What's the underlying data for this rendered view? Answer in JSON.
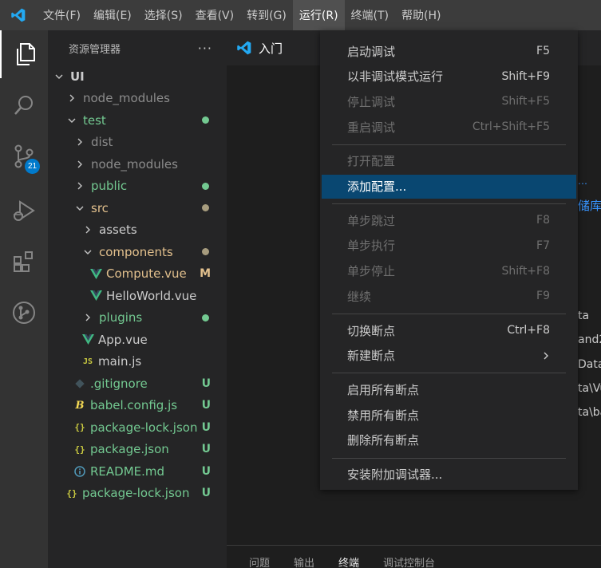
{
  "menubar": {
    "items": [
      "文件(F)",
      "编辑(E)",
      "选择(S)",
      "查看(V)",
      "转到(G)",
      "运行(R)",
      "终端(T)",
      "帮助(H)"
    ]
  },
  "activitybar": {
    "icons": [
      "files-icon",
      "search-icon",
      "source-control-icon",
      "run-debug-icon",
      "extensions-icon",
      "git-graph-icon"
    ],
    "scm_badge": "21"
  },
  "sidebar": {
    "title": "资源管理器",
    "more": "···",
    "tree": [
      {
        "label": "UI",
        "depth": 0,
        "chevron": "down",
        "icon": "",
        "color": "#cccccc",
        "bold": true,
        "decor": "",
        "dot": ""
      },
      {
        "label": "node_modules",
        "depth": 1,
        "chevron": "right",
        "icon": "",
        "color": "#8c8c8c",
        "decor": "",
        "dot": ""
      },
      {
        "label": "test",
        "depth": 1,
        "chevron": "down",
        "icon": "",
        "color": "#73c991",
        "decor": "",
        "dot": "#73c991"
      },
      {
        "label": "dist",
        "depth": 2,
        "chevron": "right",
        "icon": "",
        "color": "#8c8c8c",
        "decor": "",
        "dot": ""
      },
      {
        "label": "node_modules",
        "depth": 2,
        "chevron": "right",
        "icon": "",
        "color": "#8c8c8c",
        "decor": "",
        "dot": ""
      },
      {
        "label": "public",
        "depth": 2,
        "chevron": "right",
        "icon": "",
        "color": "#73c991",
        "decor": "",
        "dot": "#73c991"
      },
      {
        "label": "src",
        "depth": 2,
        "chevron": "down",
        "icon": "",
        "color": "#e2c08d",
        "decor": "",
        "dot": "#a79c7e"
      },
      {
        "label": "assets",
        "depth": 3,
        "chevron": "right",
        "icon": "",
        "color": "#cccccc",
        "decor": "",
        "dot": ""
      },
      {
        "label": "components",
        "depth": 3,
        "chevron": "down",
        "icon": "",
        "color": "#e2c08d",
        "decor": "",
        "dot": "#a79c7e"
      },
      {
        "label": "Compute.vue",
        "depth": 4,
        "chevron": "",
        "icon": "vue",
        "color": "#e2c08d",
        "decor": "M",
        "decorColor": "#e2c08d",
        "dot": ""
      },
      {
        "label": "HelloWorld.vue",
        "depth": 4,
        "chevron": "",
        "icon": "vue",
        "color": "#cccccc",
        "decor": "",
        "dot": ""
      },
      {
        "label": "plugins",
        "depth": 3,
        "chevron": "right",
        "icon": "",
        "color": "#73c991",
        "decor": "",
        "dot": "#73c991"
      },
      {
        "label": "App.vue",
        "depth": 3,
        "chevron": "",
        "icon": "vue",
        "color": "#cccccc",
        "decor": "",
        "dot": ""
      },
      {
        "label": "main.js",
        "depth": 3,
        "chevron": "",
        "icon": "js",
        "color": "#cccccc",
        "decor": "",
        "dot": ""
      },
      {
        "label": ".gitignore",
        "depth": 2,
        "chevron": "",
        "icon": "git",
        "color": "#73c991",
        "decor": "U",
        "decorColor": "#73c991",
        "dot": ""
      },
      {
        "label": "babel.config.js",
        "depth": 2,
        "chevron": "",
        "icon": "babel",
        "color": "#73c991",
        "decor": "U",
        "decorColor": "#73c991",
        "dot": ""
      },
      {
        "label": "package-lock.json",
        "depth": 2,
        "chevron": "",
        "icon": "json",
        "color": "#73c991",
        "decor": "U",
        "decorColor": "#73c991",
        "dot": ""
      },
      {
        "label": "package.json",
        "depth": 2,
        "chevron": "",
        "icon": "json",
        "color": "#73c991",
        "decor": "U",
        "decorColor": "#73c991",
        "dot": ""
      },
      {
        "label": "README.md",
        "depth": 2,
        "chevron": "",
        "icon": "info",
        "color": "#73c991",
        "decor": "U",
        "decorColor": "#73c991",
        "dot": ""
      },
      {
        "label": "package-lock.json",
        "depth": 1,
        "chevron": "",
        "icon": "json",
        "color": "#73c991",
        "decor": "U",
        "decorColor": "#73c991",
        "dot": ""
      }
    ]
  },
  "editor": {
    "tab_label": "入门",
    "link_fragment": "储库,",
    "text_fragments": [
      "ta",
      "and2",
      "Data",
      "ta\\Vu",
      "ta\\ba"
    ]
  },
  "panel": {
    "tabs": [
      "问题",
      "输出",
      "终端",
      "调试控制台"
    ],
    "active": "终端"
  },
  "run_menu": {
    "items": [
      {
        "label": "启动调试",
        "shortcut": "F5",
        "state": "enabled"
      },
      {
        "label": "以非调试模式运行",
        "shortcut": "Shift+F9",
        "state": "enabled"
      },
      {
        "label": "停止调试",
        "shortcut": "Shift+F5",
        "state": "disabled"
      },
      {
        "label": "重启调试",
        "shortcut": "Ctrl+Shift+F5",
        "state": "disabled"
      },
      {
        "separator": true
      },
      {
        "label": "打开配置",
        "shortcut": "",
        "state": "disabled"
      },
      {
        "label": "添加配置...",
        "shortcut": "",
        "state": "highlight"
      },
      {
        "separator": true
      },
      {
        "label": "单步跳过",
        "shortcut": "F8",
        "state": "disabled"
      },
      {
        "label": "单步执行",
        "shortcut": "F7",
        "state": "disabled"
      },
      {
        "label": "单步停止",
        "shortcut": "Shift+F8",
        "state": "disabled"
      },
      {
        "label": "继续",
        "shortcut": "F9",
        "state": "disabled"
      },
      {
        "separator": true
      },
      {
        "label": "切换断点",
        "shortcut": "Ctrl+F8",
        "state": "enabled"
      },
      {
        "label": "新建断点",
        "shortcut": "",
        "submenu": true,
        "state": "enabled"
      },
      {
        "separator": true
      },
      {
        "label": "启用所有断点",
        "shortcut": "",
        "state": "enabled"
      },
      {
        "label": "禁用所有断点",
        "shortcut": "",
        "state": "enabled"
      },
      {
        "label": "删除所有断点",
        "shortcut": "",
        "state": "enabled"
      },
      {
        "separator": true
      },
      {
        "label": "安装附加调试器...",
        "shortcut": "",
        "state": "enabled"
      }
    ]
  },
  "colors": {
    "accent": "#007acc",
    "highlight": "#094771",
    "git_untracked": "#73c991",
    "git_modified": "#e2c08d",
    "vue": "#41b883",
    "js": "#cbcb41",
    "link": "#3794ff"
  }
}
